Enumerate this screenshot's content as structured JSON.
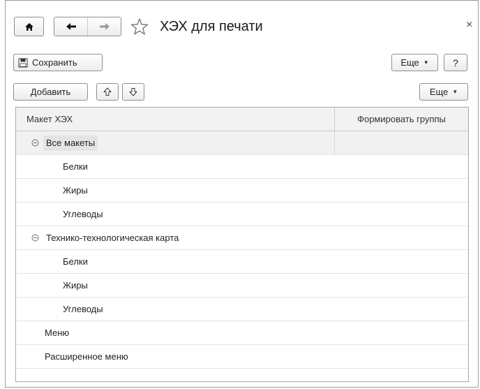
{
  "window": {
    "title": "ХЭХ для печати",
    "close_label": "×"
  },
  "toolbar1": {
    "save_label": "Сохранить",
    "more_label": "Еще",
    "help_label": "?"
  },
  "toolbar2": {
    "add_label": "Добавить",
    "more_label": "Еще"
  },
  "table": {
    "columns": [
      "Макет ХЭХ",
      "Формировать группы"
    ],
    "rows": [
      {
        "label": "Все макеты",
        "level": 0,
        "expandable": true,
        "selected": true
      },
      {
        "label": "Белки",
        "level": 1
      },
      {
        "label": "Жиры",
        "level": 1
      },
      {
        "label": "Углеводы",
        "level": 1
      },
      {
        "label": "Технико-технологическая карта",
        "level": 0,
        "expandable": true
      },
      {
        "label": "Белки",
        "level": 1
      },
      {
        "label": "Жиры",
        "level": 1
      },
      {
        "label": "Углеводы",
        "level": 1
      },
      {
        "label": "Меню",
        "level": 0
      },
      {
        "label": "Расширенное меню",
        "level": 0
      }
    ]
  },
  "icons": {
    "home": "home-icon",
    "back": "arrow-left-icon",
    "forward": "arrow-right-icon",
    "favorite": "star-icon",
    "save": "floppy-disk-icon",
    "move_up": "arrow-up-icon",
    "move_down": "arrow-down-icon",
    "collapse": "collapse-circle-icon"
  }
}
